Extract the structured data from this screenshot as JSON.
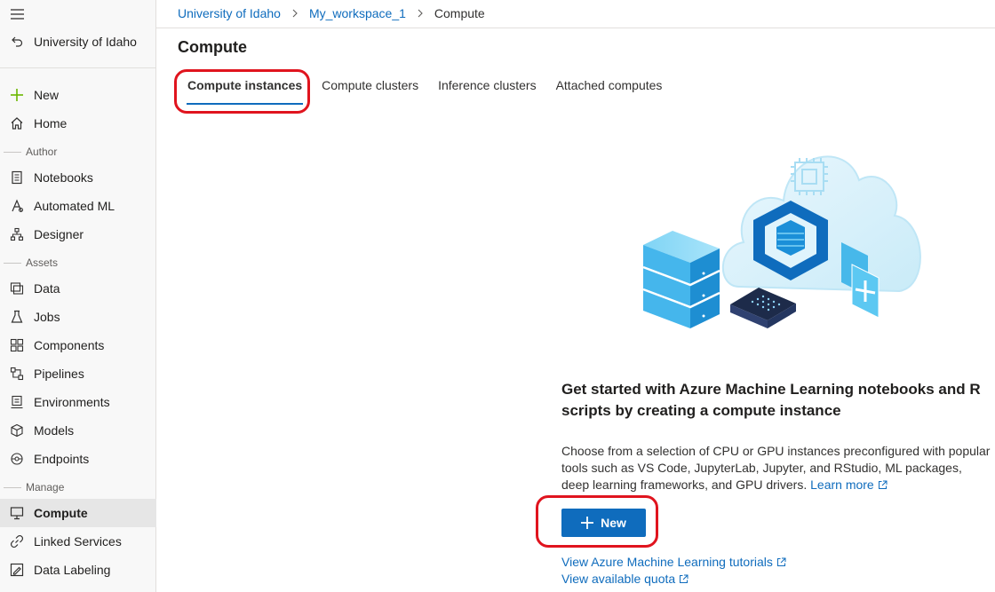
{
  "breadcrumb": {
    "org": "University of Idaho",
    "workspace": "My_workspace_1",
    "current": "Compute"
  },
  "sidebar": {
    "back_label": "University of Idaho",
    "new_label": "New",
    "home_label": "Home",
    "sections": {
      "author": "Author",
      "assets": "Assets",
      "manage": "Manage"
    },
    "items": [
      {
        "label": "Notebooks",
        "icon": "notebook-icon"
      },
      {
        "label": "Automated ML",
        "icon": "automated-ml-icon"
      },
      {
        "label": "Designer",
        "icon": "designer-icon"
      },
      {
        "label": "Data",
        "icon": "data-icon"
      },
      {
        "label": "Jobs",
        "icon": "flask-icon"
      },
      {
        "label": "Components",
        "icon": "components-icon"
      },
      {
        "label": "Pipelines",
        "icon": "pipelines-icon"
      },
      {
        "label": "Environments",
        "icon": "environments-icon"
      },
      {
        "label": "Models",
        "icon": "cube-icon"
      },
      {
        "label": "Endpoints",
        "icon": "endpoints-icon"
      },
      {
        "label": "Compute",
        "icon": "monitor-icon",
        "active": true
      },
      {
        "label": "Linked Services",
        "icon": "linked-services-icon"
      },
      {
        "label": "Data Labeling",
        "icon": "data-labeling-icon"
      }
    ]
  },
  "page": {
    "title": "Compute"
  },
  "tabs": [
    {
      "label": "Compute instances",
      "active": true
    },
    {
      "label": "Compute clusters"
    },
    {
      "label": "Inference clusters"
    },
    {
      "label": "Attached computes"
    }
  ],
  "empty_state": {
    "title": "Get started with Azure Machine Learning notebooks and R scripts by creating a compute instance",
    "description": "Choose from a selection of CPU or GPU instances preconfigured with popular tools such as VS Code, JupyterLab, Jupyter, and RStudio, ML packages, deep learning frameworks, and GPU drivers.",
    "learn_more": "Learn more",
    "new_button": "New",
    "tutorials_link": "View Azure Machine Learning tutorials",
    "quota_link": "View available quota"
  },
  "colors": {
    "accent": "#0f6cbd",
    "annotation": "#e0141e",
    "new_icon": "#6bb700"
  }
}
